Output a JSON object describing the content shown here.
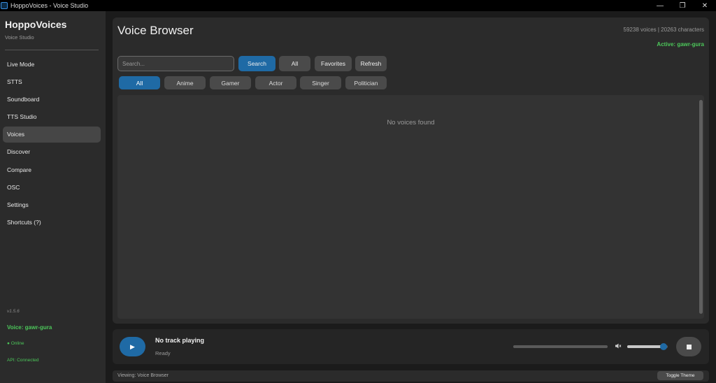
{
  "window": {
    "title": "HoppoVoices - Voice Studio",
    "controls": {
      "minimize": "—",
      "restore": "❐",
      "close": "✕"
    }
  },
  "sidebar": {
    "brand": "HoppoVoices",
    "subtitle": "Voice Studio",
    "items": [
      {
        "label": "Live Mode"
      },
      {
        "label": "STTS"
      },
      {
        "label": "Soundboard"
      },
      {
        "label": "TTS Studio"
      },
      {
        "label": "Voices"
      },
      {
        "label": "Discover"
      },
      {
        "label": "Compare"
      },
      {
        "label": "OSC"
      },
      {
        "label": "Settings"
      },
      {
        "label": "Shortcuts (?)"
      }
    ],
    "active_index": 4,
    "version": "v1.5.6",
    "voice": "Voice: gawr-gura",
    "online": "● Online",
    "api": "API: Connected"
  },
  "main": {
    "title": "Voice Browser",
    "stats": "59238 voices | 20263 characters",
    "active_voice": "Active: gawr-gura",
    "search": {
      "placeholder": "Search...",
      "value": ""
    },
    "buttons": {
      "search": "Search",
      "all": "All",
      "favorites": "Favorites",
      "refresh": "Refresh"
    },
    "categories": [
      "All",
      "Anime",
      "Gamer",
      "Actor",
      "Singer",
      "Politician"
    ],
    "active_category": "All",
    "empty_message": "No voices found"
  },
  "player": {
    "play_icon": "▶",
    "track": "No track playing",
    "status": "Ready",
    "progress": 0.0,
    "volume": 0.9
  },
  "statusbar": {
    "viewing": "Viewing: Voice Browser",
    "toggle_theme": "Toggle Theme"
  },
  "colors": {
    "accent": "#1f6aa5",
    "status_green": "#4cc75a",
    "sidebar_bg": "#2b2b2b",
    "app_bg": "#1b1b1b"
  }
}
